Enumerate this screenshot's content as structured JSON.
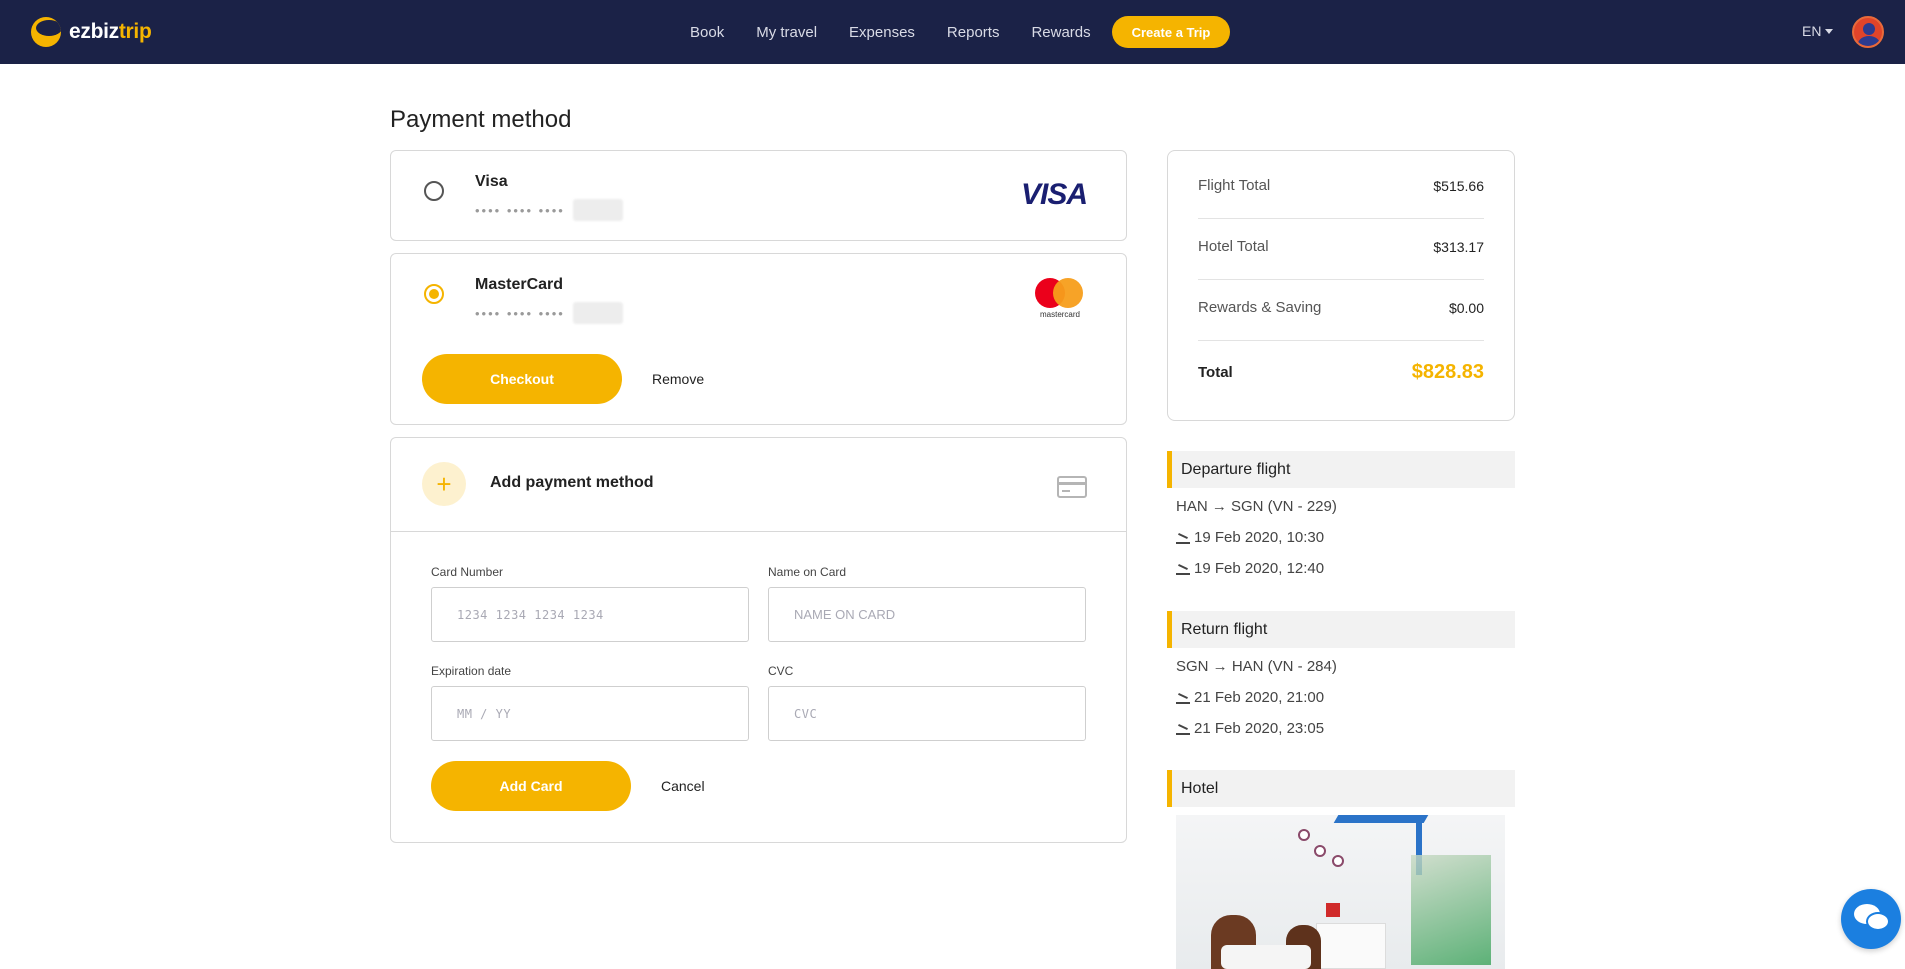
{
  "brand": {
    "name_white": "ezbiz",
    "name_yellow": "trip"
  },
  "nav": {
    "links": [
      "Book",
      "My travel",
      "Expenses",
      "Reports",
      "Rewards"
    ],
    "create_trip": "Create a Trip",
    "language": "EN"
  },
  "page": {
    "title": "Payment method"
  },
  "cards": [
    {
      "name": "Visa",
      "mask": "•••• •••• ••••",
      "logo": "VISA",
      "selected": false
    },
    {
      "name": "MasterCard",
      "mask": "•••• •••• ••••",
      "logo": "mastercard",
      "selected": true
    }
  ],
  "card_actions": {
    "checkout": "Checkout",
    "remove": "Remove"
  },
  "add_payment": {
    "title": "Add payment method",
    "plus": "+",
    "fields": {
      "card_number": {
        "label": "Card Number",
        "placeholder": "1234 1234 1234 1234"
      },
      "name_on_card": {
        "label": "Name on Card",
        "placeholder": "NAME ON CARD"
      },
      "expiration": {
        "label": "Expiration date",
        "placeholder": "MM / YY"
      },
      "cvc": {
        "label": "CVC",
        "placeholder": "CVC"
      }
    },
    "add_card": "Add Card",
    "cancel": "Cancel"
  },
  "summary": {
    "flight_total_label": "Flight Total",
    "flight_total": "$515.66",
    "hotel_total_label": "Hotel Total",
    "hotel_total": "$313.17",
    "rewards_label": "Rewards & Saving",
    "rewards": "$0.00",
    "total_label": "Total",
    "total": "$828.83"
  },
  "departure": {
    "title": "Departure flight",
    "route": "HAN → SGN (VN - 229)",
    "depart": "19 Feb 2020, 10:30",
    "arrive": "19 Feb 2020, 12:40"
  },
  "return": {
    "title": "Return flight",
    "route": "SGN → HAN (VN - 284)",
    "depart": "21 Feb 2020, 21:00",
    "arrive": "21 Feb 2020, 23:05"
  },
  "hotel": {
    "title": "Hotel"
  },
  "colors": {
    "navy": "#1b2247",
    "accent": "#f5b400",
    "chat": "#1b7fe0"
  }
}
